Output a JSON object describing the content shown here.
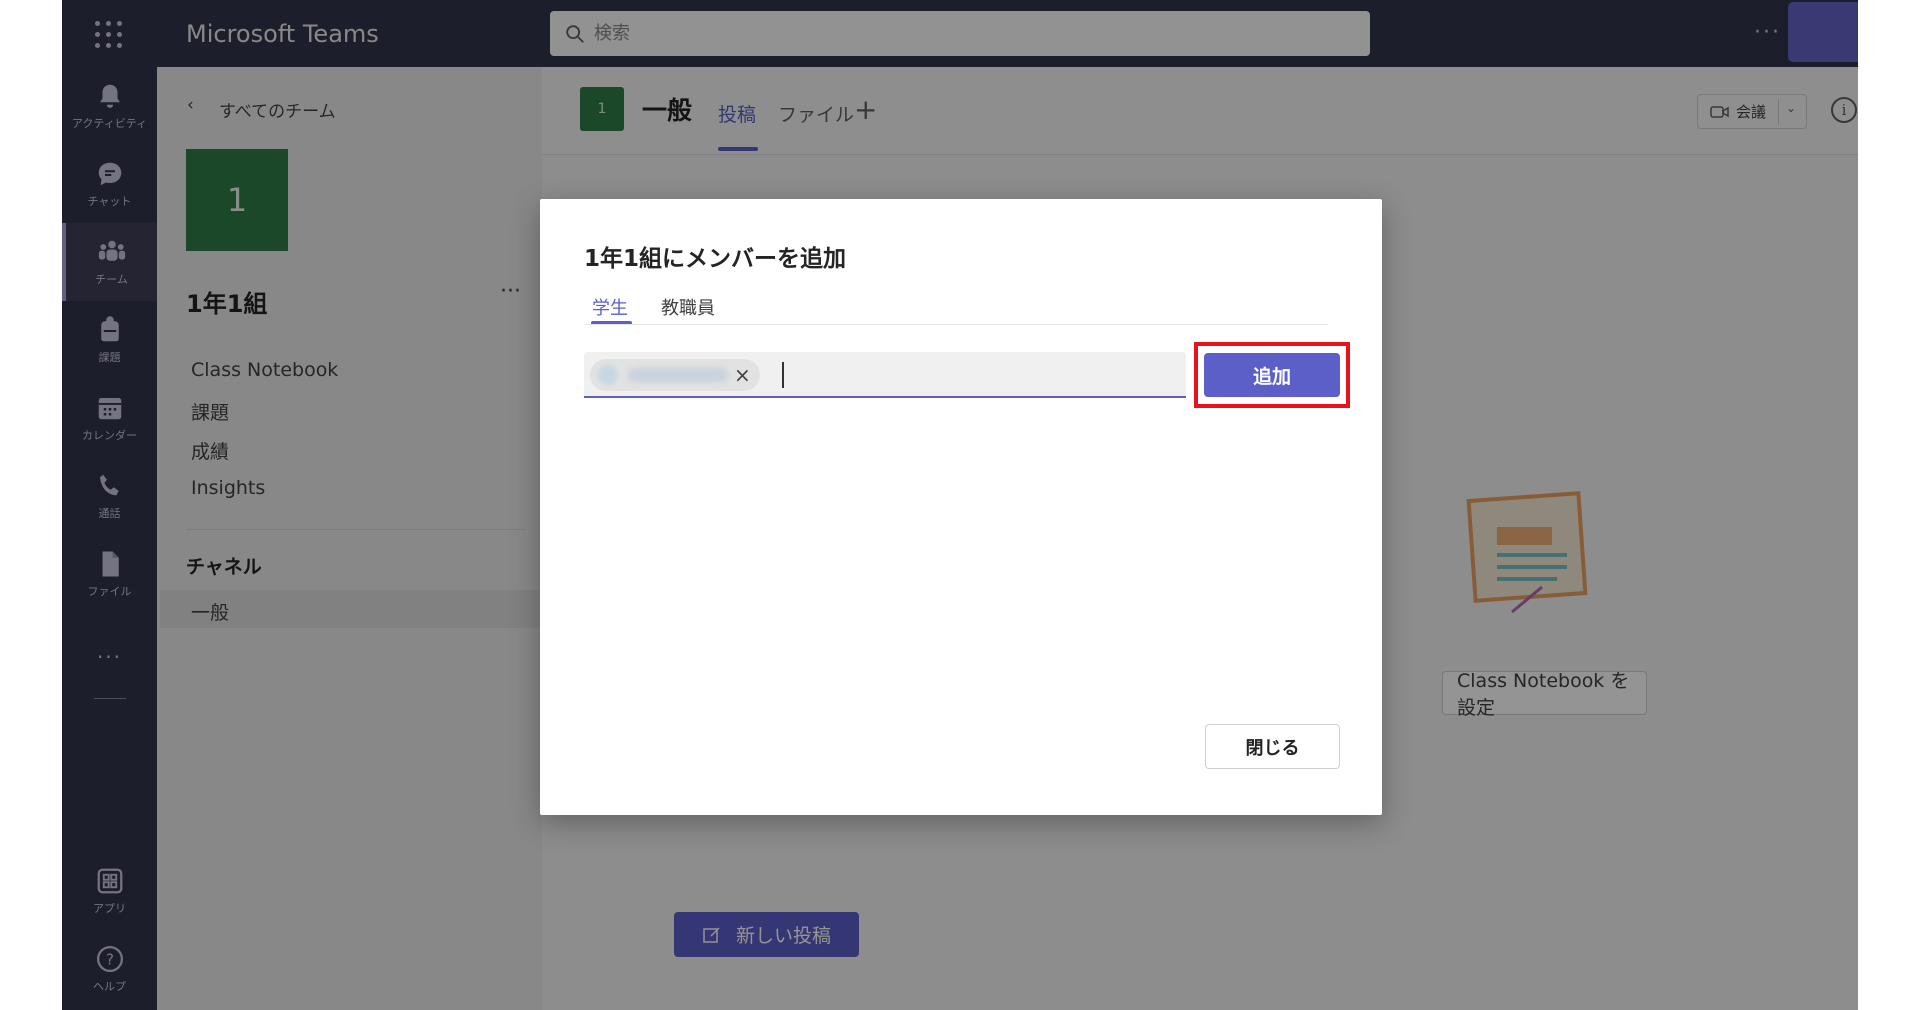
{
  "app": {
    "title": "Microsoft Teams"
  },
  "search": {
    "placeholder": "検索"
  },
  "topbar": {
    "more": "···"
  },
  "rail": {
    "items": [
      {
        "label": "アクティビティ",
        "icon": "bell-icon"
      },
      {
        "label": "チャット",
        "icon": "chat-icon"
      },
      {
        "label": "チーム",
        "icon": "teams-icon"
      },
      {
        "label": "課題",
        "icon": "backpack-icon"
      },
      {
        "label": "カレンダー",
        "icon": "calendar-icon"
      },
      {
        "label": "通話",
        "icon": "phone-icon"
      },
      {
        "label": "ファイル",
        "icon": "file-icon"
      }
    ],
    "more": "···",
    "apps_label": "アプリ",
    "help_label": "ヘルプ"
  },
  "channel_pane": {
    "back_label": "すべてのチーム",
    "team_tile": "1",
    "team_name": "1年1組",
    "team_more": "···",
    "links": [
      "Class Notebook",
      "課題",
      "成績",
      "Insights"
    ],
    "channels_title": "チャネル",
    "channels": [
      "一般"
    ]
  },
  "channel_header": {
    "tile": "1",
    "name": "一般",
    "tabs": [
      "投稿",
      "ファイル"
    ],
    "add_tab": "+",
    "meet_label": "会議",
    "info": "i",
    "more": "···"
  },
  "main": {
    "setup_button": "Class Notebook を設定",
    "new_post": "新しい投稿"
  },
  "modal": {
    "title": "1年1組にメンバーを追加",
    "tabs": [
      "学生",
      "教職員"
    ],
    "chip_remove": "×",
    "add_button": "追加",
    "close_button": "閉じる"
  },
  "colors": {
    "accent": "#5b5fc7",
    "rail": "#33344a",
    "team_tile": "#2e7d45",
    "highlight": "#e8121f"
  }
}
